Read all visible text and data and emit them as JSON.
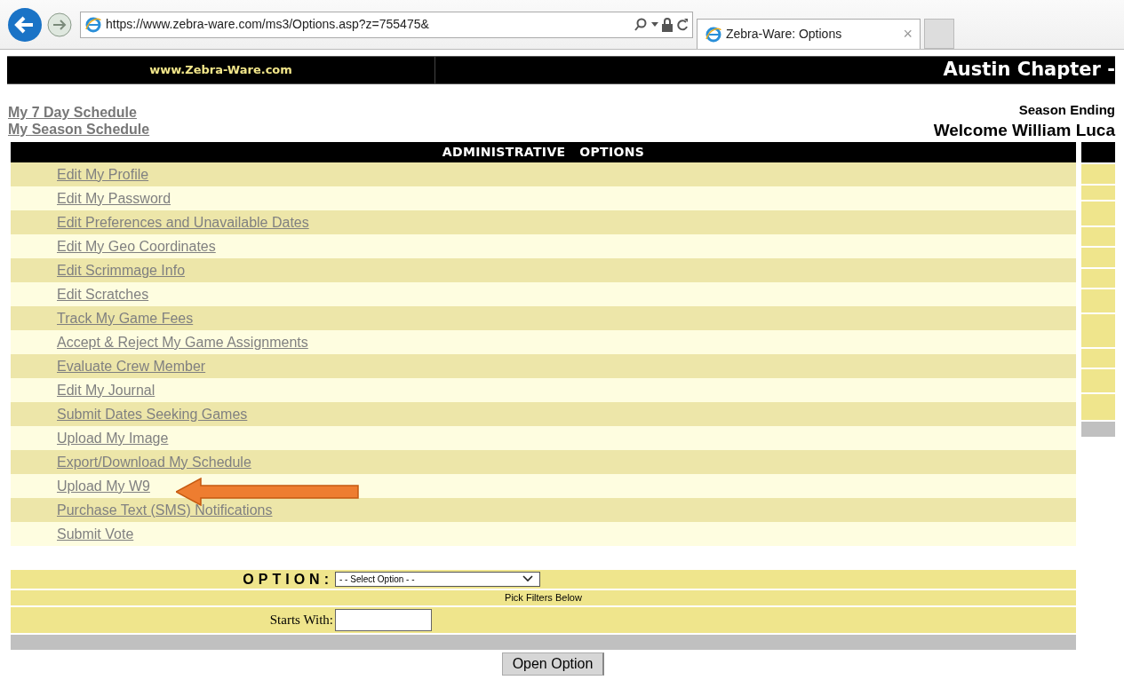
{
  "browser": {
    "url": "https://www.zebra-ware.com/ms3/Options.asp?z=755475&",
    "tab_title": "Zebra-Ware: Options",
    "tab_close": "×"
  },
  "banner": {
    "site": "www.Zebra-Ware.com",
    "title": "Austin Chapter -"
  },
  "links": [
    "My 7 Day Schedule",
    "My Season Schedule"
  ],
  "season_text": "Season Ending",
  "welcome": "Welcome William Luca",
  "admin": {
    "header": "ADMINISTRATIVE   OPTIONS",
    "items": [
      "Edit My Profile",
      "Edit My Password",
      "Edit Preferences and Unavailable Dates",
      "Edit My Geo Coordinates",
      "Edit Scrimmage Info",
      "Edit Scratches",
      "Track My Game Fees",
      "Accept & Reject My Game Assignments",
      "Evaluate Crew Member",
      "Edit My Journal",
      "Submit Dates Seeking Games",
      "Upload My Image",
      "Export/Download My Schedule",
      "Upload My W9",
      "Purchase Text (SMS) Notifications",
      "Submit Vote"
    ]
  },
  "form": {
    "option_label": "OPTION:",
    "select_value": "- - Select Option - -",
    "pick_filters": "Pick Filters Below",
    "starts_with_label": "Starts With:"
  },
  "button": "Open Option"
}
